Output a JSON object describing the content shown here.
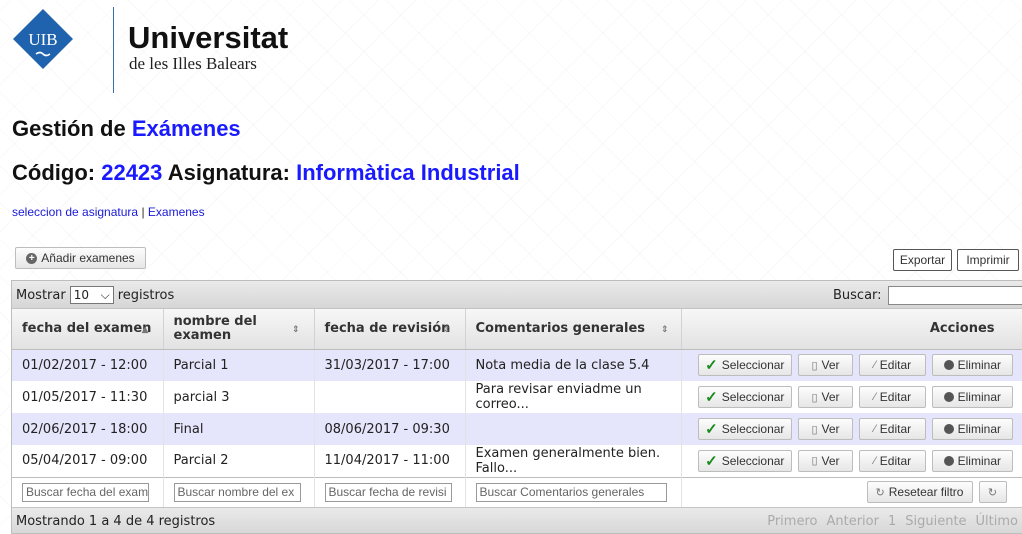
{
  "header": {
    "logo_text": "UIB",
    "university_name": "Universitat",
    "university_subtitle": "de les Illes Balears"
  },
  "title": {
    "prefix": "Gestión de",
    "highlight": "Exámenes"
  },
  "subtitle": {
    "code_label": "Código:",
    "code_value": "22423",
    "subject_label": "Asignatura:",
    "subject_value": "Informàtica Industrial"
  },
  "breadcrumb": {
    "link1": "seleccion de asignatura",
    "separator": "|",
    "link2": "Examenes"
  },
  "toolbar": {
    "add_button": "Añadir examenes",
    "export_button": "Exportar",
    "print_button": "Imprimir"
  },
  "table_controls": {
    "show_label": "Mostrar",
    "page_length": "10",
    "records_label": "registros",
    "search_label": "Buscar:",
    "search_value": ""
  },
  "columns": [
    {
      "label": "fecha del examen"
    },
    {
      "label": "nombre del examen"
    },
    {
      "label": "fecha de revisión"
    },
    {
      "label": "Comentarios generales"
    },
    {
      "label": "Acciones"
    }
  ],
  "rows": [
    {
      "fecha": "01/02/2017 - 12:00",
      "nombre": "Parcial 1",
      "revision": "31/03/2017 - 17:00",
      "comentario": "Nota media de la clase 5.4"
    },
    {
      "fecha": "01/05/2017 - 11:30",
      "nombre": "parcial 3",
      "revision": "",
      "comentario": "Para revisar enviadme un correo..."
    },
    {
      "fecha": "02/06/2017 - 18:00",
      "nombre": "Final",
      "revision": "08/06/2017 - 09:30",
      "comentario": ""
    },
    {
      "fecha": "05/04/2017 - 09:00",
      "nombre": "Parcial 2",
      "revision": "11/04/2017 - 11:00",
      "comentario": "Examen generalmente bien. Fallo..."
    }
  ],
  "actions": {
    "select": "Seleccionar",
    "view": "Ver",
    "edit": "Editar",
    "delete": "Eliminar"
  },
  "filters": {
    "fecha_placeholder": "Buscar fecha del exam",
    "nombre_placeholder": "Buscar nombre del ex",
    "revision_placeholder": "Buscar fecha de revisi",
    "comentario_placeholder": "Buscar Comentarios generales",
    "reset_button": "Resetear filtro"
  },
  "footer": {
    "info": "Mostrando 1 a 4 de 4 registros",
    "first": "Primero",
    "previous": "Anterior",
    "page": "1",
    "next": "Siguiente",
    "last": "Último"
  }
}
